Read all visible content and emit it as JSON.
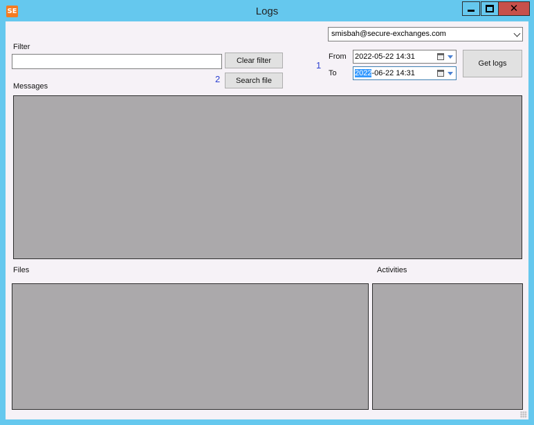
{
  "window": {
    "title": "Logs",
    "icon_text": "SE",
    "controls": {
      "minimize": "minimize-icon",
      "maximize": "maximize-icon",
      "close": "close-icon"
    }
  },
  "filter": {
    "label": "Filter",
    "value": "",
    "clear_button": "Clear filter",
    "search_button": "Search file",
    "annotation": "2"
  },
  "account": {
    "selected": "smisbah@secure-exchanges.com"
  },
  "dates": {
    "annotation": "1",
    "from_label": "From",
    "from_value": "2022-05-22 14:31",
    "to_label": "To",
    "to_selected": "2022",
    "to_rest": "-06-22 14:31"
  },
  "get_logs_button": "Get logs",
  "sections": {
    "messages": "Messages",
    "files": "Files",
    "activities": "Activities"
  },
  "colors": {
    "titlebar": "#65c8ee",
    "close": "#c7504a",
    "panel": "#aba9ab",
    "client": "#f6f2f7",
    "annotation": "#2a3fd0"
  }
}
